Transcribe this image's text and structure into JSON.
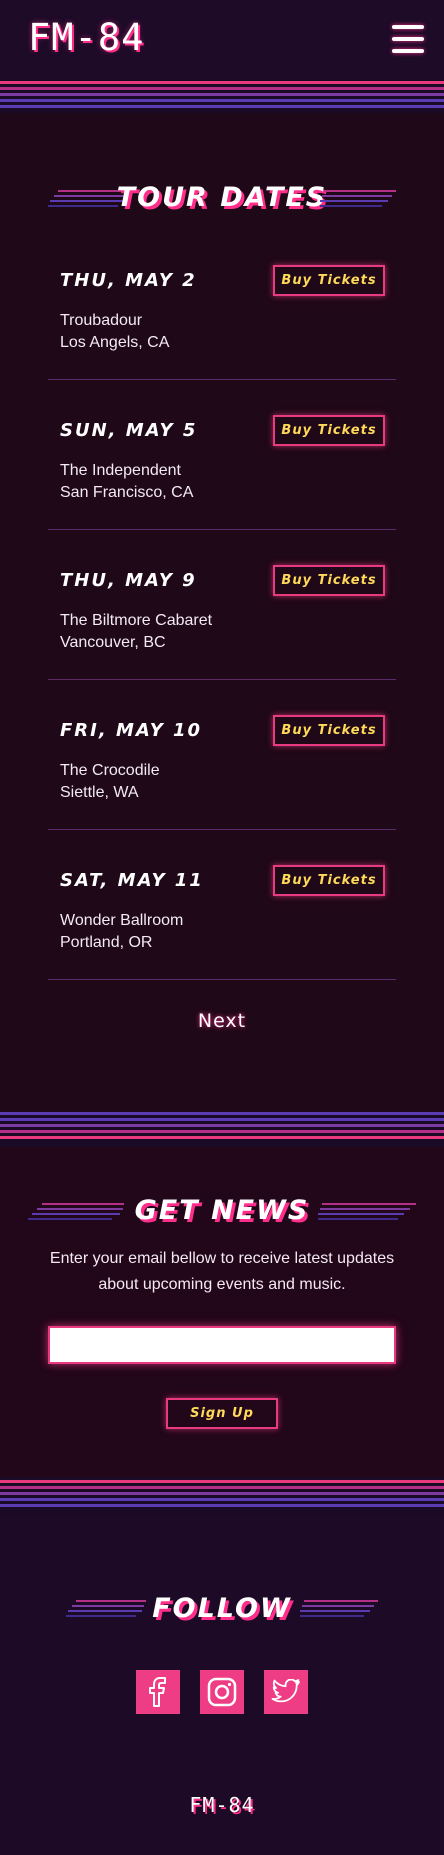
{
  "header": {
    "logo": "FM-84",
    "menu_icon": "hamburger-menu-icon"
  },
  "tour": {
    "title": "TOUR DATES",
    "dates": [
      {
        "date": "THU, MAY 2",
        "venue": "Troubadour",
        "city": "Los Angels, CA",
        "button": "Buy Tickets"
      },
      {
        "date": "SUN, MAY 5",
        "venue": "The Independent",
        "city": "San Francisco, CA",
        "button": "Buy Tickets"
      },
      {
        "date": "THU, MAY 9",
        "venue": "The Biltmore Cabaret",
        "city": "Vancouver, BC",
        "button": "Buy Tickets"
      },
      {
        "date": "FRI, MAY 10",
        "venue": "The Crocodile",
        "city": "Siettle, WA",
        "button": "Buy Tickets"
      },
      {
        "date": "SAT, MAY 11",
        "venue": "Wonder Ballroom",
        "city": "Portland, OR",
        "button": "Buy Tickets"
      }
    ],
    "next": "Next"
  },
  "news": {
    "title": "GET NEWS",
    "text": "Enter your email bellow to receive latest updates about upcoming events and music.",
    "email_value": "",
    "button": "Sign Up"
  },
  "follow": {
    "title": "FOLLOW",
    "icons": [
      "facebook-icon",
      "instagram-icon",
      "twitter-icon"
    ]
  },
  "footer": {
    "logo": "FM-84"
  },
  "colors": {
    "background": "#1b0a25",
    "accent_pink": "#e83a80",
    "button_text": "#ffd95a",
    "stripe_purple": "#5a3cb0"
  }
}
